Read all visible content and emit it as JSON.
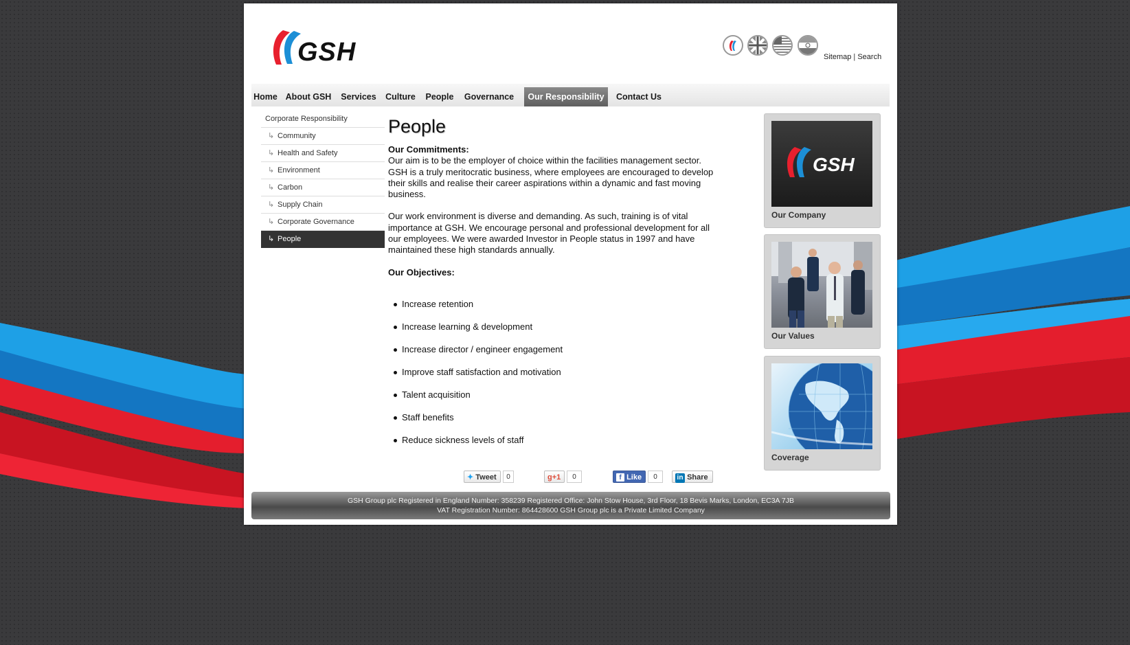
{
  "brand": {
    "logo_text": "GSH"
  },
  "top_links": {
    "sitemap": "Sitemap",
    "separator": "|",
    "search": "Search"
  },
  "flags": [
    "gsh-logo-flag-icon",
    "uk-flag-icon",
    "us-flag-icon",
    "india-flag-icon"
  ],
  "nav": {
    "items": [
      {
        "label": "Home"
      },
      {
        "label": "About GSH"
      },
      {
        "label": "Services"
      },
      {
        "label": "Culture"
      },
      {
        "label": "People"
      },
      {
        "label": "Governance"
      },
      {
        "label": "Our Responsibility"
      },
      {
        "label": "Contact Us"
      }
    ],
    "active": "Our Responsibility"
  },
  "submenu": {
    "parent": "Corporate Responsibility",
    "items": [
      {
        "label": "Community"
      },
      {
        "label": "Health and Safety"
      },
      {
        "label": "Environment"
      },
      {
        "label": "Carbon"
      },
      {
        "label": "Supply Chain"
      },
      {
        "label": "Corporate Governance"
      },
      {
        "label": "People"
      }
    ],
    "active": "People"
  },
  "content": {
    "title": "People",
    "commitments_heading": "Our Commitments:",
    "paragraph1": "Our aim is to be the employer of choice within the facilities management sector. GSH is a truly meritocratic business, where employees are encouraged to develop their skills and realise their career aspirations within a dynamic and fast moving business.",
    "paragraph2": "Our work environment is diverse and demanding. As such, training is of vital importance at GSH. We encourage personal and professional development for all our employees. We were awarded Investor in People status in 1997 and have maintained these high standards annually.",
    "objectives_heading": "Our Objectives:",
    "objectives": [
      "Increase retention",
      "Increase learning & development",
      "Increase director / engineer engagement",
      "Improve staff satisfaction and motivation",
      "Talent acquisition",
      "Staff benefits",
      "Reduce sickness levels of staff"
    ]
  },
  "social": {
    "tweet": "Tweet",
    "tweet_count": "0",
    "gplus": "+1",
    "gplus_count": "0",
    "like": "Like",
    "like_count": "0",
    "share": "Share"
  },
  "sidebar_boxes": [
    {
      "caption": "Our Company",
      "logo_text": "GSH"
    },
    {
      "caption": "Our Values"
    },
    {
      "caption": "Coverage"
    }
  ],
  "footer": {
    "line1": "GSH Group plc Registered in England Number: 358239 Registered Office: John Stow House, 3rd Floor, 18 Bevis Marks, London, EC3A 7JB",
    "line2": "VAT Registration Number: 864428600 GSH Group plc is a Private Limited Company"
  },
  "colors": {
    "brand_red": "#e8202e",
    "brand_blue": "#1c8fd6",
    "nav_active": "#6b6b6b",
    "background": "#3a3a3c"
  }
}
